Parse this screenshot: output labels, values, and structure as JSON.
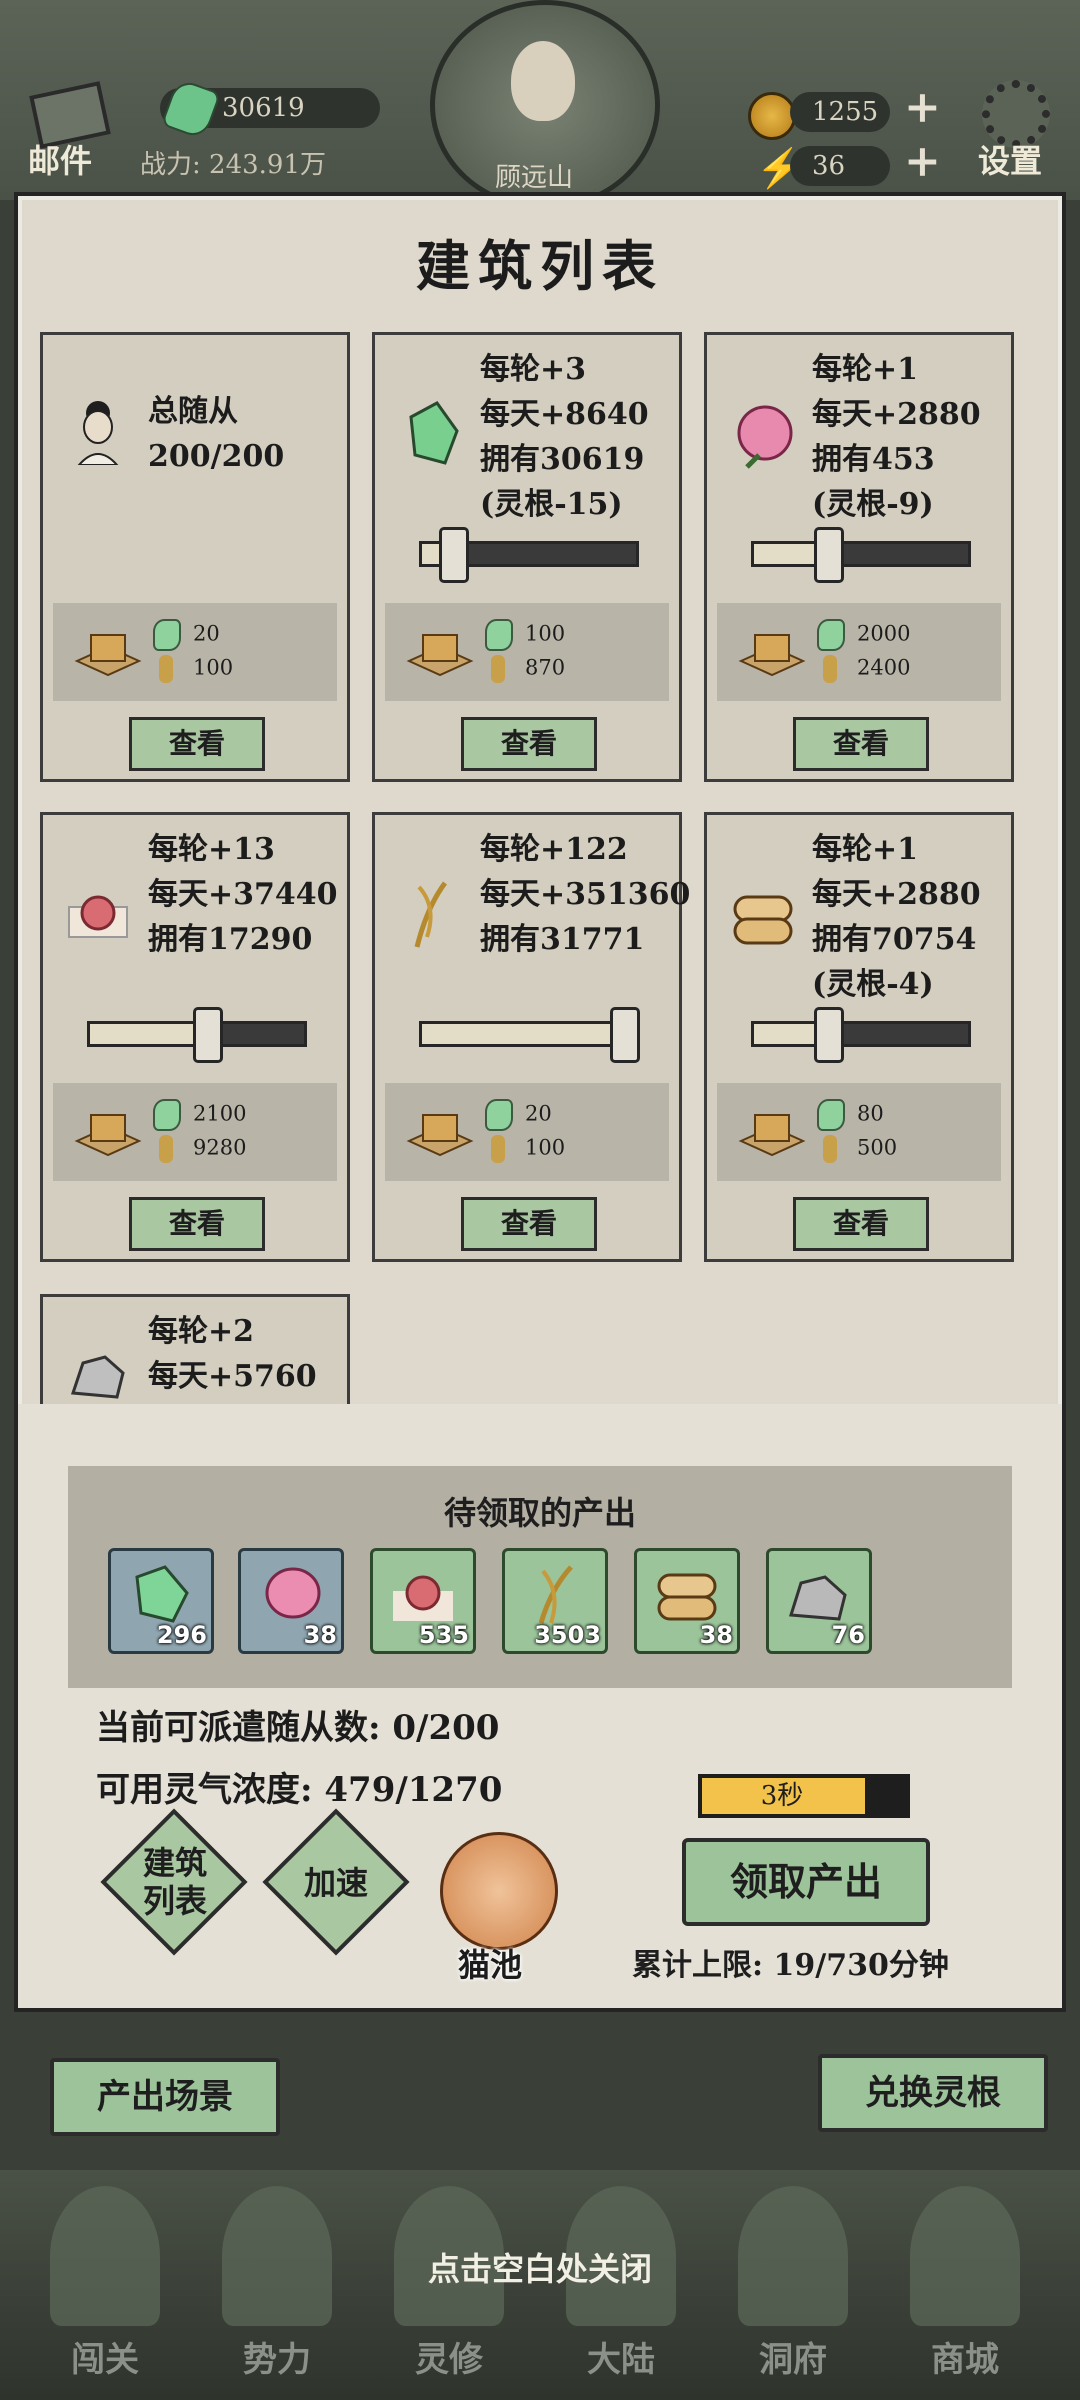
{
  "hud": {
    "mail_label": "邮件",
    "jade_count": "30619",
    "power": "战力: 243.91万",
    "player_name": "顾远山",
    "coin_count": "1255",
    "energy_count": "36",
    "settings_label": "设置"
  },
  "panel": {
    "title": "建筑列表"
  },
  "cards": [
    {
      "lines": "总随从\n200/200",
      "cost_jade": "20",
      "cost_wood": "100",
      "view": "查看"
    },
    {
      "lines": "每轮+3\n每天+8640\n拥有30619\n(灵根-15)",
      "slider": 0.15,
      "cost_jade": "100",
      "cost_wood": "870",
      "view": "查看"
    },
    {
      "lines": "每轮+1\n每天+2880\n拥有453\n(灵根-9)",
      "slider": 0.35,
      "cost_jade": "2000",
      "cost_wood": "2400",
      "view": "查看"
    },
    {
      "lines": "每轮+13\n每天+37440\n拥有17290",
      "slider": 0.55,
      "cost_jade": "2100",
      "cost_wood": "9280",
      "view": "查看"
    },
    {
      "lines": "每轮+122\n每天+351360\n拥有31771",
      "slider": 0.95,
      "cost_jade": "20",
      "cost_wood": "100",
      "view": "查看"
    },
    {
      "lines": "每轮+1\n每天+2880\n拥有70754\n(灵根-4)",
      "slider": 0.35,
      "cost_jade": "80",
      "cost_wood": "500",
      "view": "查看"
    },
    {
      "lines": "每轮+2\n每天+5760"
    }
  ],
  "pending": {
    "title": "待领取的产出",
    "items": [
      {
        "icon": "jade-icon",
        "count": "296"
      },
      {
        "icon": "peach-icon",
        "count": "38"
      },
      {
        "icon": "elixir-icon",
        "count": "535"
      },
      {
        "icon": "grain-icon",
        "count": "3503"
      },
      {
        "icon": "log-icon",
        "count": "38"
      },
      {
        "icon": "stone-icon",
        "count": "76"
      }
    ]
  },
  "stats": {
    "followers": "当前可派遣随从数: 0/200",
    "aura": "可用灵气浓度: 479/1270",
    "timer": "3秒",
    "timer_progress": 0.8
  },
  "actions": {
    "building_list": "建筑\n列表",
    "speed_up": "加速",
    "cat_pool": "猫池",
    "claim": "领取产出",
    "limit": "累计上限: 19/730分钟"
  },
  "footer_buttons": {
    "scene": "产出场景",
    "exchange": "兑换灵根"
  },
  "close_hint": "点击空白处关闭",
  "nav": [
    "闯关",
    "势力",
    "灵修",
    "大陆",
    "洞府",
    "商城"
  ]
}
